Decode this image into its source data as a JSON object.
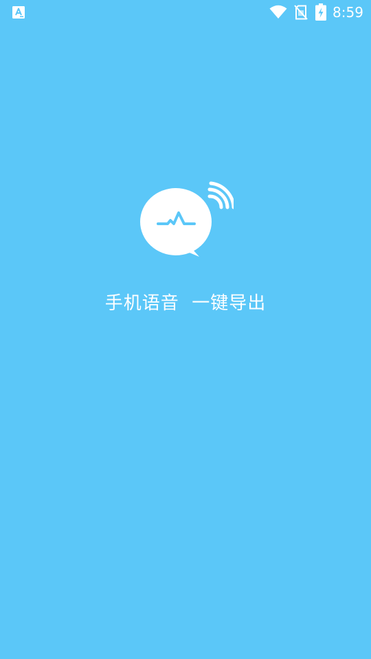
{
  "status_bar": {
    "time": "8:59",
    "notification_icon": "text-a-icon",
    "icons": [
      "wifi-icon",
      "no-sim-icon",
      "battery-charging-icon"
    ]
  },
  "splash": {
    "logo_icon": "voice-chat-bubble-icon",
    "slogan": "手机语音  一键导出"
  },
  "colors": {
    "background": "#5bc7f8",
    "foreground": "#ffffff"
  }
}
